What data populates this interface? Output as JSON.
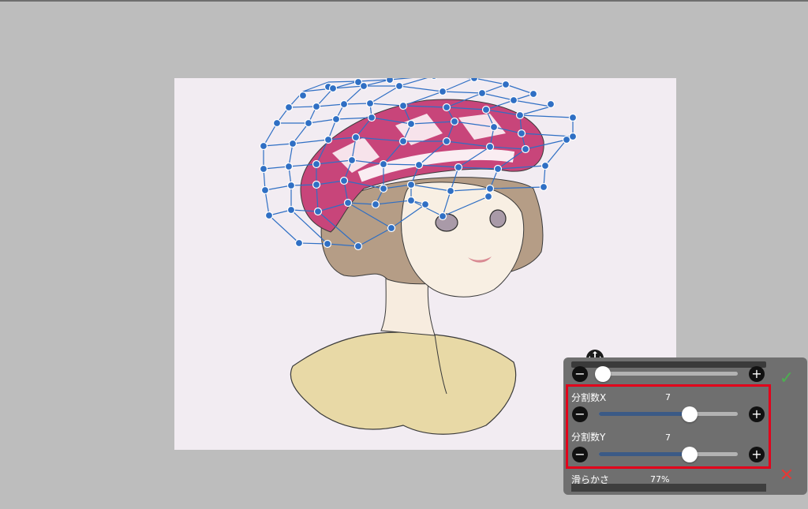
{
  "panel": {
    "top_slider": {
      "minus_icon": "−",
      "plus_icon": "+",
      "level": 0.0
    },
    "divisions_x": {
      "label": "分割数X",
      "value": "7",
      "minus_icon": "−",
      "plus_icon": "+",
      "level": 0.65
    },
    "divisions_y": {
      "label": "分割数Y",
      "value": "7",
      "minus_icon": "−",
      "plus_icon": "+",
      "level": 0.65
    },
    "smoothness": {
      "label": "滑らかさ",
      "value": "77%"
    },
    "confirm_icon": "✓",
    "cancel_icon": "✕"
  },
  "colors": {
    "background": "#bdbdbd",
    "canvas": "#f2ecf2",
    "mesh": "#2f6fc4",
    "slider_fill": "#3b5a86",
    "highlight": "#e3001b",
    "confirm": "#4caf50",
    "cancel": "#e53935"
  },
  "icons": {
    "move_handle": "move-arrows-icon",
    "confirm": "checkmark-icon",
    "cancel": "close-icon"
  }
}
